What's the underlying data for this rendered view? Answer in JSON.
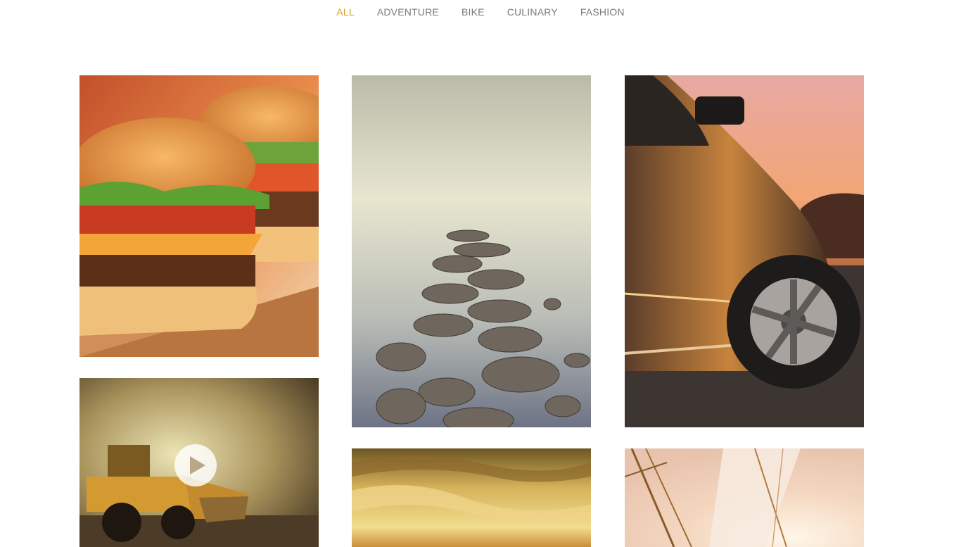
{
  "filters": [
    {
      "label": "ALL",
      "active": true
    },
    {
      "label": "ADVENTURE",
      "active": false
    },
    {
      "label": "BIKE",
      "active": false
    },
    {
      "label": "CULINARY",
      "active": false
    },
    {
      "label": "FASHION",
      "active": false
    }
  ],
  "colors": {
    "active_filter": "#d4a017",
    "inactive_filter": "#7a7a7a"
  },
  "tiles": [
    {
      "name": "burger-photo",
      "has_play_button": false
    },
    {
      "name": "stones-in-water-photo",
      "has_play_button": false
    },
    {
      "name": "car-sunset-photo",
      "has_play_button": false
    },
    {
      "name": "wheel-loader-photo",
      "has_play_button": true
    },
    {
      "name": "golden-clouds-photo",
      "has_play_button": false
    },
    {
      "name": "sailboat-photo",
      "has_play_button": false
    }
  ]
}
